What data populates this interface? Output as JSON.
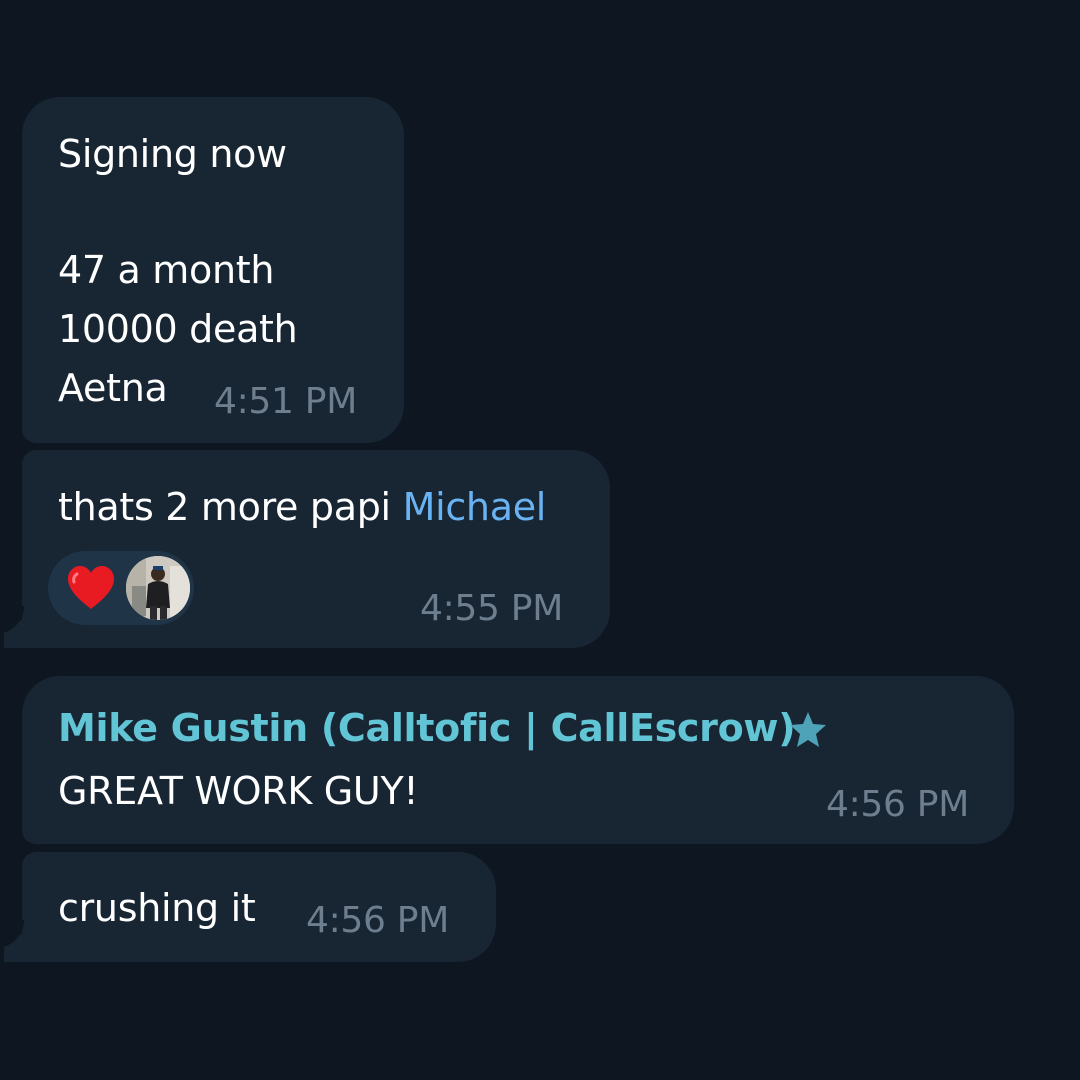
{
  "messages": [
    {
      "lines": [
        "Signing now",
        "",
        "47 a month",
        "10000 death",
        "Aetna"
      ],
      "time": "4:51 PM"
    },
    {
      "text": "thats 2 more papi ",
      "mention": "Michael",
      "time": "4:55 PM",
      "reaction": {
        "icon": "heart-icon",
        "avatar": "avatar"
      }
    },
    {
      "sender": "Mike Gustin (Calltofic | CallEscrow)",
      "sender_badge_icon": "star-icon",
      "text": "GREAT WORK GUY!",
      "time": "4:56 PM"
    },
    {
      "text": "crushing it",
      "time": "4:56 PM"
    }
  ],
  "colors": {
    "background": "#0e1621",
    "bubble": "#182533",
    "mention": "#6ab3f3",
    "sender": "#62c5d6",
    "timestamp": "#6d7f8f",
    "heart": "#e81b23"
  }
}
